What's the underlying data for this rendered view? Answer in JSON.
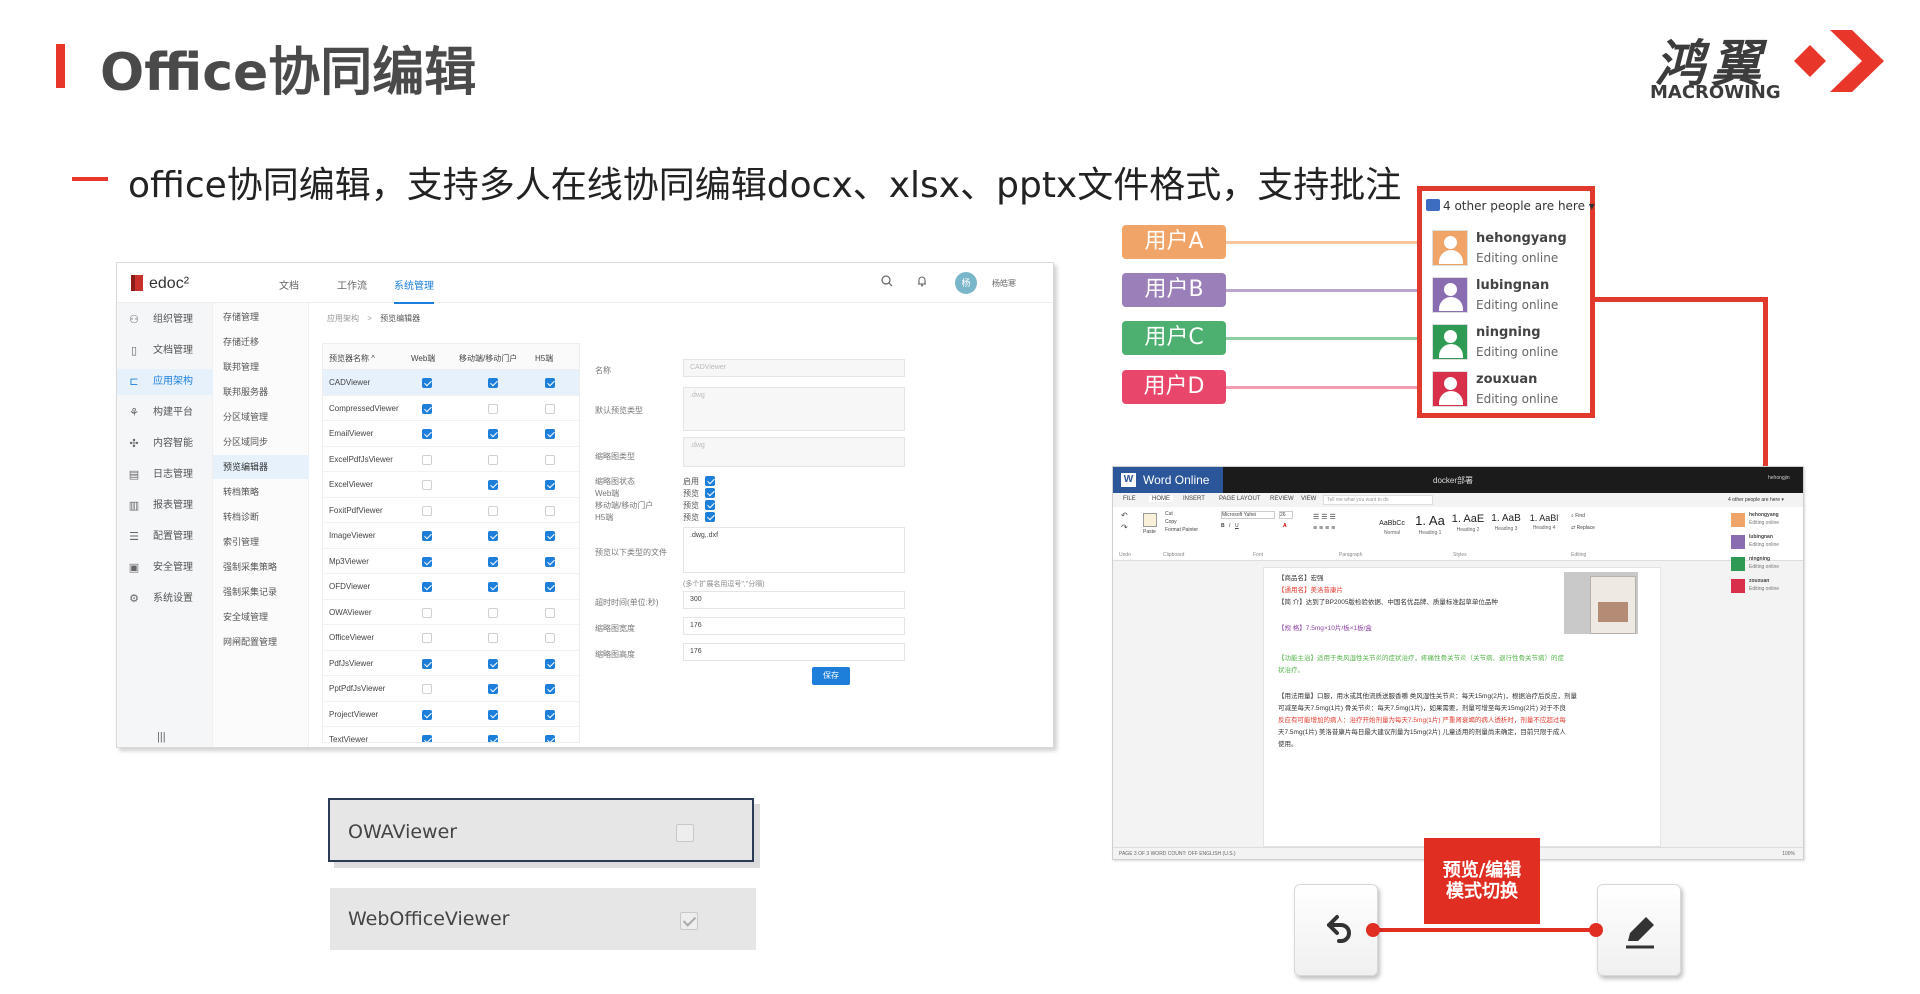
{
  "header": {
    "title": "Office协同编辑",
    "logo_cn": "鸿翼",
    "logo_en": "MACROWING",
    "subtitle": "office协同编辑，支持多人在线协同编辑docx、xlsx、pptx文件格式，支持批注",
    "accent_color": "#e8362a"
  },
  "edoc": {
    "logo": "edoc²",
    "nav": [
      "文档",
      "工作流",
      "系统管理"
    ],
    "nav_active": "系统管理",
    "avatar_text": "杨",
    "user_name": "杨皓寒",
    "icons": [
      "search-icon",
      "bell-icon"
    ],
    "sidebar": [
      {
        "label": "组织管理",
        "icon": "org-icon"
      },
      {
        "label": "文档管理",
        "icon": "doc-icon"
      },
      {
        "label": "应用架构",
        "icon": "arch-icon",
        "active": true
      },
      {
        "label": "构建平台",
        "icon": "build-icon"
      },
      {
        "label": "内容智能",
        "icon": "ai-icon"
      },
      {
        "label": "日志管理",
        "icon": "log-icon"
      },
      {
        "label": "报表管理",
        "icon": "chart-icon"
      },
      {
        "label": "配置管理",
        "icon": "config-icon"
      },
      {
        "label": "安全管理",
        "icon": "security-icon"
      },
      {
        "label": "系统设置",
        "icon": "settings-icon"
      }
    ],
    "menu_toggle": "|||",
    "submenu": [
      "存储管理",
      "存储迁移",
      "联邦管理",
      "联邦服务器",
      "分区域管理",
      "分区域同步",
      "预览编辑器",
      "转档策略",
      "转档诊断",
      "索引管理",
      "强制采集策略",
      "强制采集记录",
      "安全域管理",
      "网闸配置管理"
    ],
    "submenu_active": "预览编辑器",
    "breadcrumb": [
      "应用架构",
      ">",
      "预览编辑器"
    ],
    "table": {
      "headers": [
        "预览器名称 ^",
        "Web端",
        "移动端/移动门户",
        "H5端"
      ],
      "rows": [
        {
          "name": "CADViewer",
          "web": true,
          "mobile": true,
          "h5": true,
          "selected": true
        },
        {
          "name": "CompressedViewer",
          "web": true,
          "mobile": false,
          "h5": false
        },
        {
          "name": "EmailViewer",
          "web": true,
          "mobile": true,
          "h5": true
        },
        {
          "name": "ExcelPdfJsViewer",
          "web": false,
          "mobile": false,
          "h5": false
        },
        {
          "name": "ExcelViewer",
          "web": false,
          "mobile": true,
          "h5": true
        },
        {
          "name": "FoxitPdfViewer",
          "web": false,
          "mobile": false,
          "h5": false
        },
        {
          "name": "ImageViewer",
          "web": true,
          "mobile": true,
          "h5": true
        },
        {
          "name": "Mp3Viewer",
          "web": true,
          "mobile": true,
          "h5": true
        },
        {
          "name": "OFDViewer",
          "web": true,
          "mobile": true,
          "h5": true
        },
        {
          "name": "OWAViewer",
          "web": false,
          "mobile": false,
          "h5": false
        },
        {
          "name": "OfficeViewer",
          "web": false,
          "mobile": false,
          "h5": false
        },
        {
          "name": "PdfJsViewer",
          "web": true,
          "mobile": true,
          "h5": true
        },
        {
          "name": "PptPdfJsViewer",
          "web": false,
          "mobile": true,
          "h5": true
        },
        {
          "name": "ProjectViewer",
          "web": true,
          "mobile": true,
          "h5": true
        },
        {
          "name": "TextViewer",
          "web": true,
          "mobile": true,
          "h5": true
        }
      ]
    },
    "form": {
      "name_label": "名称",
      "name_value": "CADViewer",
      "default_type_label": "默认预览类型",
      "default_type_value": ".dwg",
      "thumb_type_label": "缩略图类型",
      "thumb_type_value": ".dwg",
      "thumb_status_label": "缩略图状态",
      "thumb_status_value": "启用",
      "web_label": "Web端",
      "web_value": "预览",
      "mobile_label": "移动端/移动门户",
      "mobile_value": "预览",
      "h5_label": "H5端",
      "h5_value": "预览",
      "ext_label": "预览以下类型的文件",
      "ext_value": ".dwg,.dxf",
      "ext_hint": "(多个扩展名用逗号\",\"分隔)",
      "timeout_label": "超时时间(单位:秒)",
      "timeout_value": "300",
      "thumb_w_label": "缩略图宽度",
      "thumb_w_value": "176",
      "thumb_h_label": "缩略图高度",
      "thumb_h_value": "176",
      "save_label": "保存"
    }
  },
  "viewers": [
    {
      "name": "OWAViewer",
      "checked": false,
      "outlined": true
    },
    {
      "name": "WebOfficeViewer",
      "checked": true,
      "outlined": false
    }
  ],
  "users": [
    {
      "label": "用户A",
      "name": "hehongyang",
      "status": "Editing online",
      "color": "#f0a468"
    },
    {
      "label": "用户B",
      "name": "lubingnan",
      "status": "Editing online",
      "color": "#9a7fb8"
    },
    {
      "label": "用户C",
      "name": "ningning",
      "status": "Editing online",
      "color": "#4daf70"
    },
    {
      "label": "用户D",
      "name": "zouxuan",
      "status": "Editing online",
      "color": "#e8476b"
    }
  ],
  "presence_header": "4 other people are here",
  "word": {
    "brand": "Word Online",
    "doc_name": "docker部署",
    "user": "hehongjin",
    "tabs": [
      "FILE",
      "HOME",
      "INSERT",
      "PAGE LAYOUT",
      "REVIEW",
      "VIEW"
    ],
    "tell_me": "Tell me what you want to do",
    "ribbon_groups": [
      "Undo",
      "Clipboard",
      "Font",
      "Paragraph",
      "Styles",
      "Editing"
    ],
    "clipboard": [
      "Cut",
      "Copy",
      "Paste",
      "Format Painter"
    ],
    "font_name": "Microsoft Yahei",
    "font_size": "26",
    "styles": [
      {
        "preview": "AaBbCc",
        "name": "Normal"
      },
      {
        "preview": "1. Aa",
        "name": "Heading 1"
      },
      {
        "preview": "1. AaE",
        "name": "Heading 2"
      },
      {
        "preview": "1. AaB",
        "name": "Heading 3"
      },
      {
        "preview": "1. AaBl",
        "name": "Heading 4"
      }
    ],
    "editing": [
      "Find",
      "Replace"
    ],
    "status": "PAGE 3 OF 3     WORD COUNT: OFF     ENGLISH (U.S.)",
    "zoom": "100%",
    "lines": [
      {
        "text": "【商品名】宏强",
        "style": ""
      },
      {
        "text": "【通用名】美洛昔康片",
        "style": "red"
      },
      {
        "text": "【简 介】达到了BP2005版检验依据、中国名优品牌、质量标准起草单位品种",
        "style": ""
      },
      {
        "text": "【规 格】7.5mg×10片/板×1板/盒",
        "style": "purple"
      },
      {
        "text": "【功能主治】适用于类风湿性关节炎的症状治疗，疼痛性骨关节炎（关节病、退行性骨关节病）的症",
        "style": "green"
      },
      {
        "text": "状治疗。",
        "style": "green"
      },
      {
        "text": "【用法用量】口服，用水或其他流质送服香嚼 类风湿性关节炎：每天15mg(2片)，根据治疗后反应，剂量",
        "style": ""
      },
      {
        "text": "可减至每天7.5mg(1片) 骨关节炎：每天7.5mg(1片)，如果需要，剂量可增至每天15mg(2片) 对于不良",
        "style": ""
      },
      {
        "text": "反应有可能增加的病人：治疗开始剂量为每天7.5mg(1片) 严重肾衰竭的病人透析时，剂量不应超过每",
        "style": "mixed"
      },
      {
        "text": "天7.5mg(1片) 美洛昔康片每日最大建议剂量为15mg(2片) 儿童适用的剂量尚未确定，目前只限于成人",
        "style": ""
      },
      {
        "text": "使用。",
        "style": ""
      }
    ]
  },
  "mode_switch": {
    "label_line1": "预览/编辑",
    "label_line2": "模式切换",
    "color": "#e02e23",
    "left_icon": "undo-icon",
    "right_icon": "pencil-icon"
  }
}
